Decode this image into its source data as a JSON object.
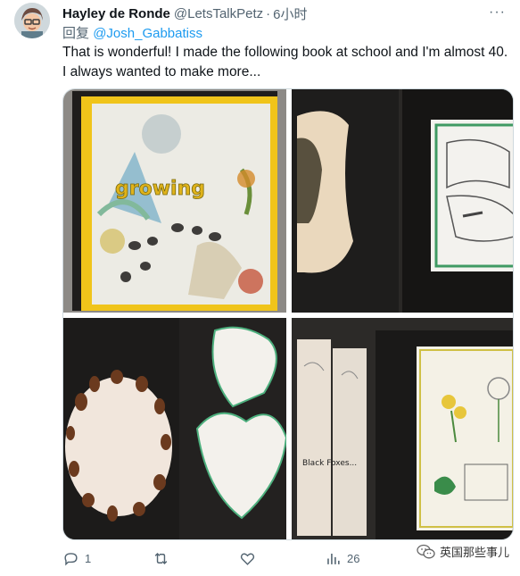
{
  "tweet": {
    "author_name": "Hayley de Ronde",
    "author_handle": "@LetsTalkPetz",
    "separator": "·",
    "time": "6小时",
    "more": "···",
    "reply_prefix": "回复",
    "reply_mention": "@Josh_Gabbatiss",
    "text_line1": "That is wonderful! I made the following book at school and I'm almost 40.",
    "text_line2": "I always wanted to make more..."
  },
  "media": {
    "photo1_title": "growing",
    "photo4_label": "Black Foxes..."
  },
  "actions": {
    "reply_count": "1",
    "retweet_count": "",
    "like_count": "",
    "views_count": "26"
  },
  "watermark": {
    "text": "英国那些事儿",
    "icon": "wechat-icon"
  },
  "colors": {
    "link": "#1d9bf0",
    "muted": "#536471",
    "text": "#0f1419"
  }
}
